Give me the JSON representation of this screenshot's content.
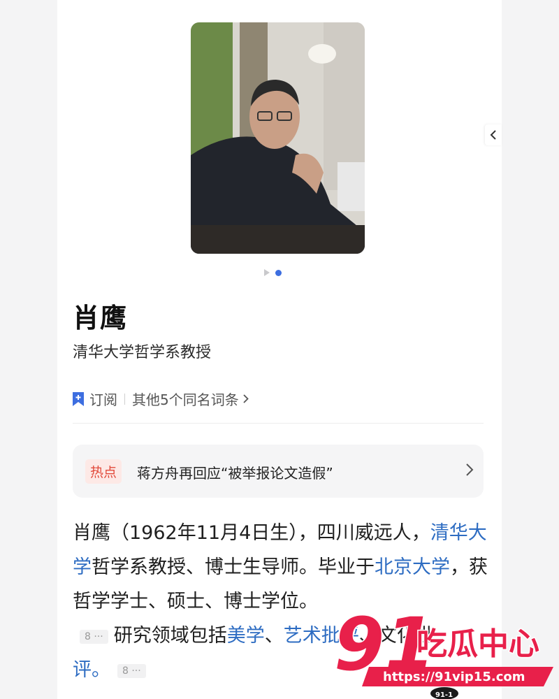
{
  "profile": {
    "name": "肖鹰",
    "title": "清华大学哲学系教授"
  },
  "actions": {
    "subscribe": "订阅",
    "same_name": "其他5个同名词条"
  },
  "hot": {
    "badge": "热点",
    "text": "蒋方舟再回应“被举报论文造假”"
  },
  "intro": {
    "p1": "肖鹰（1962年11月4日生），四川威远人，",
    "link1": "清华大学",
    "p2": "哲学系教授、博士生导师。毕业于",
    "link2": "北京大学",
    "p3": "，获哲学学士、硕士、博士学位。",
    "ref1": "8 ···",
    "p4": "研究领域包括",
    "link3": "美学",
    "p5": "、",
    "link4": "艺术批评",
    "p6": "、文化批",
    "p7": "评。",
    "ref2": "8 ···"
  },
  "watermark": {
    "number": "91",
    "label": "吃瓜中心",
    "url": "https://91vip15.com",
    "tag": "91-1"
  },
  "colors": {
    "accent": "#3d6ee0",
    "link": "#2d6cc2",
    "hot": "#e24a3b",
    "watermark": "#e8204a"
  }
}
